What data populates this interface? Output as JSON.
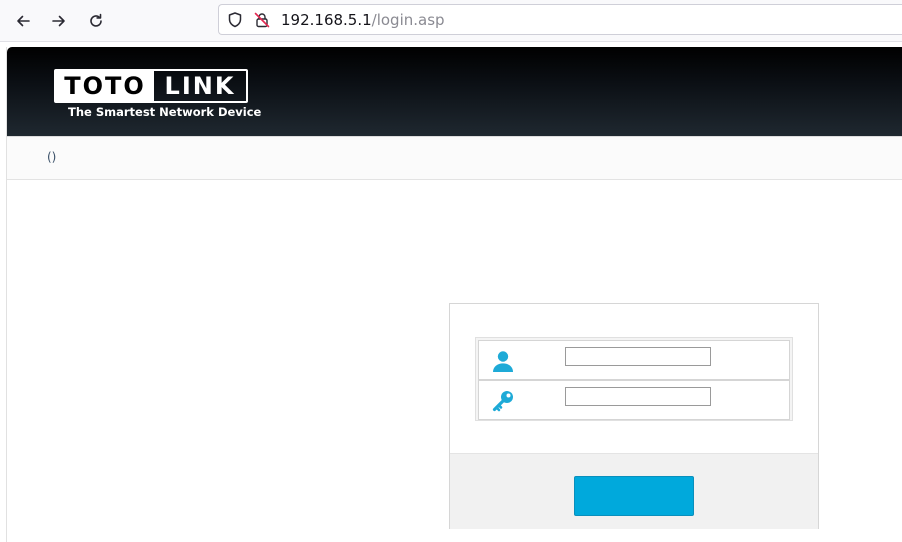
{
  "browser": {
    "url_host": "192.168.5.1",
    "url_path": "/login.asp",
    "icons": [
      "back-arrow-icon",
      "forward-arrow-icon",
      "reload-icon",
      "shield-icon",
      "insecure-lock-icon"
    ]
  },
  "header": {
    "logo_part1": "TOTO",
    "logo_part2": "LINK",
    "tagline": "The Smartest Network Device"
  },
  "subnav": {
    "text": "()"
  },
  "login": {
    "username_value": "",
    "password_value": "",
    "button_label": "",
    "icons": [
      "user-icon",
      "key-icon"
    ]
  },
  "colors": {
    "accent": "#00a9dc",
    "icon": "#1eaad7",
    "header_bg": "#0b0f14"
  }
}
